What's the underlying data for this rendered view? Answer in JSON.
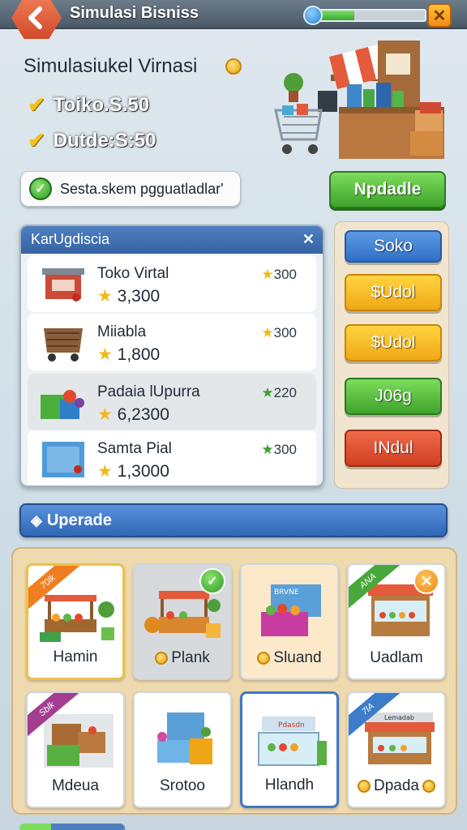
{
  "header": {
    "title": "Simulasi Bisniss",
    "progress": 0.35
  },
  "summary": {
    "title": "Simulasiukel Virnasi",
    "stat_1": "Toiko.S.50",
    "stat_2": "Dutde:S:50"
  },
  "status": {
    "text": "Sesta.skem pgguatladlar'"
  },
  "actions": {
    "update_label": "Npdadle"
  },
  "catalog": {
    "title": "KarUgdiscia",
    "items": [
      {
        "name": "Toko Virtal",
        "price": "3,300",
        "rating": "300",
        "icon": "shop-stand-icon"
      },
      {
        "name": "Miiabla",
        "price": "1,800",
        "rating": "300",
        "icon": "cart-icon"
      },
      {
        "name": "Padaia lUpurra",
        "price": "6,2300",
        "rating": "220",
        "icon": "produce-crate-icon"
      },
      {
        "name": "Samta Pial",
        "price": "1,3000",
        "rating": "300",
        "icon": "blue-box-icon"
      }
    ]
  },
  "categories": [
    {
      "label": "Soko",
      "color": "blue"
    },
    {
      "label": "$Udol",
      "color": "yellow"
    },
    {
      "label": "$Udol",
      "color": "yellow"
    },
    {
      "label": "J06g",
      "color": "green"
    },
    {
      "label": "INdul",
      "color": "red"
    }
  ],
  "upgrade": {
    "title": "Uperade",
    "tiles": [
      {
        "label": "Hamin",
        "ribbon": "70lk",
        "ribbon_color": "orange"
      },
      {
        "label": "Plank",
        "badge": "check"
      },
      {
        "label": "Sluand",
        "sign": "BRVNE"
      },
      {
        "label": "Uadlam",
        "ribbon": "ANA",
        "ribbon_color": "green",
        "badge": "x"
      },
      {
        "label": "Mdeua",
        "ribbon": "Sblk",
        "ribbon_color": "purple"
      },
      {
        "label": "Srotoo"
      },
      {
        "label": "Hlandh",
        "sign": "Pdasdn"
      },
      {
        "label": "Dpada",
        "ribbon": "7lA",
        "ribbon_color": "blue",
        "sign": "Lemadab"
      }
    ]
  },
  "colors": {
    "accent_blue": "#2f6fc6",
    "accent_green": "#3fa42c",
    "accent_orange": "#f08d12",
    "accent_red": "#cf3f22"
  }
}
